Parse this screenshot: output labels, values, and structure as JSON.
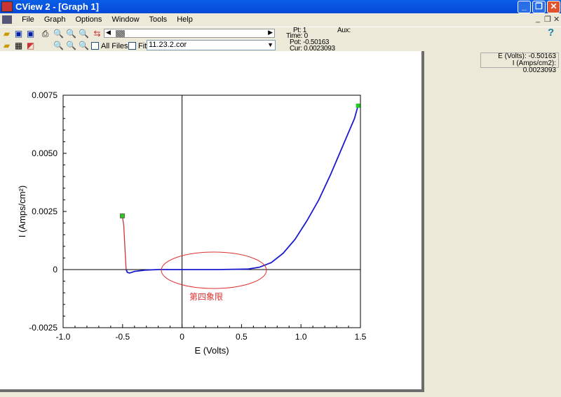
{
  "window": {
    "title": "CView 2 - [Graph 1]",
    "minimize": "_",
    "restore": "❐",
    "close": "✕"
  },
  "menu": [
    "File",
    "Graph",
    "Options",
    "Window",
    "Tools",
    "Help"
  ],
  "toolbar": {
    "all_files": "All Files",
    "fit": "Fit",
    "file": "11.23.2.cor",
    "help": "?"
  },
  "info": {
    "pt": "Pt: 1",
    "time": "Time: 0",
    "pot": "Pot: -0.50163",
    "cur": "Cur: 0.0023093",
    "aux": "Aux:"
  },
  "readout": {
    "e": "E (Volts): -0.50163",
    "i": "I (Amps/cm2): 0.0023093"
  },
  "annotation": "第四象限",
  "chart_data": {
    "type": "line",
    "xlabel": "E (Volts)",
    "ylabel": "I (Amps/cm²)",
    "xlim": [
      -1.0,
      1.5
    ],
    "ylim": [
      -0.0025,
      0.0075
    ],
    "xticks": [
      "-1.0",
      "-0.5",
      "0",
      "0.5",
      "1.0",
      "1.5"
    ],
    "yticks": [
      "0.0075",
      "0.0050",
      "0.0025",
      "0",
      "-0.0025"
    ],
    "colors": {
      "initial": "#cc3333",
      "main": "#1a1ad0",
      "marker": "#22cc22",
      "annotation": "#e03030"
    },
    "segment_initial": [
      [
        -0.502,
        0.00231
      ],
      [
        -0.49,
        0.0019
      ],
      [
        -0.48,
        0.0009
      ],
      [
        -0.47,
        0.0
      ]
    ],
    "segment_main": [
      [
        -0.47,
        0.0
      ],
      [
        -0.46,
        -0.00012
      ],
      [
        -0.44,
        -0.00015
      ],
      [
        -0.4,
        -8e-05
      ],
      [
        -0.3,
        -2e-05
      ],
      [
        -0.2,
        0
      ],
      [
        0.0,
        0
      ],
      [
        0.3,
        0
      ],
      [
        0.55,
        2e-05
      ],
      [
        0.65,
        0.0001
      ],
      [
        0.75,
        0.0003
      ],
      [
        0.85,
        0.0007
      ],
      [
        0.95,
        0.0013
      ],
      [
        1.05,
        0.0021
      ],
      [
        1.15,
        0.003
      ],
      [
        1.25,
        0.0041
      ],
      [
        1.35,
        0.0053
      ],
      [
        1.45,
        0.0065
      ],
      [
        1.48,
        0.00705
      ]
    ]
  }
}
